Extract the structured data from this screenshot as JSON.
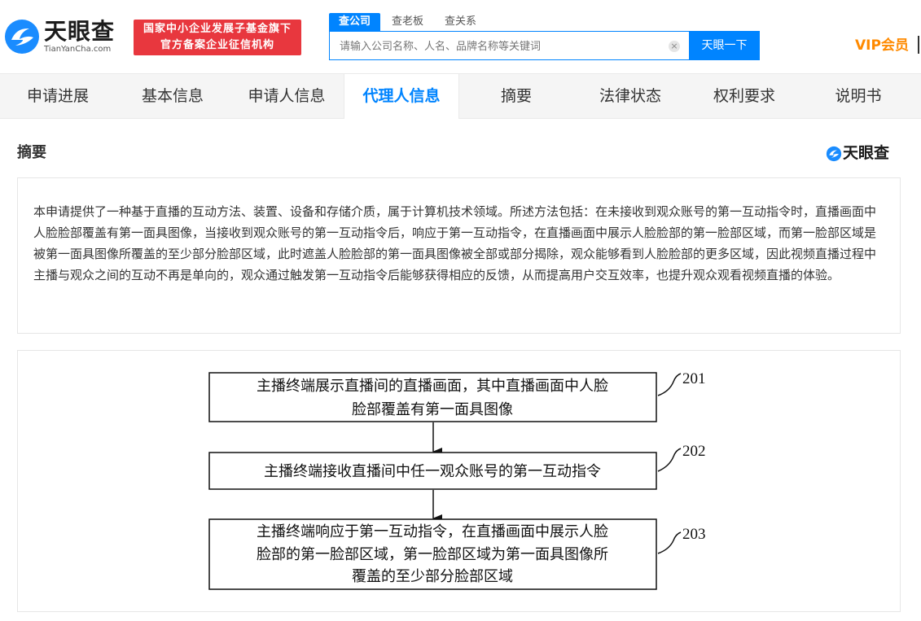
{
  "header": {
    "logo_title": "天眼查",
    "logo_domain": "TianYanCha.com",
    "badge_line1": "国家中小企业发展子基金旗下",
    "badge_line2": "官方备案企业征信机构",
    "search_tabs": [
      "查公司",
      "查老板",
      "查关系"
    ],
    "search_placeholder": "请输入公司名称、人名、品牌名称等关键词",
    "search_button": "天眼一下",
    "vip_label": "VIP会员"
  },
  "nav": {
    "tabs": [
      "申请进展",
      "基本信息",
      "申请人信息",
      "代理人信息",
      "摘要",
      "法律状态",
      "权利要求",
      "说明书"
    ],
    "active_index": 3
  },
  "abstract": {
    "title": "摘要",
    "brand": "天眼查",
    "text": "本申请提供了一种基于直播的互动方法、装置、设备和存储介质，属于计算机技术领域。所述方法包括：在未接收到观众账号的第一互动指令时，直播画面中人脸脸部覆盖有第一面具图像，当接收到观众账号的第一互动指令后，响应于第一互动指令，在直播画面中展示人脸脸部的第一脸部区域，而第一脸部区域是被第一面具图像所覆盖的至少部分脸部区域，此时遮盖人脸脸部的第一面具图像被全部或部分揭除，观众能够看到人脸脸部的更多区域，因此视频直播过程中主播与观众之间的互动不再是单向的，观众通过触发第一互动指令后能够获得相应的反馈，从而提高用户交互效率，也提升观众观看视频直播的体验。"
  },
  "figure": {
    "steps": [
      {
        "lines": [
          "主播终端展示直播间的直播画面，其中直播画面中人脸",
          "脸部覆盖有第一面具图像"
        ],
        "ref": "201"
      },
      {
        "lines": [
          "主播终端接收直播间中任一观众账号的第一互动指令"
        ],
        "ref": "202"
      },
      {
        "lines": [
          "主播终端响应于第一互动指令，在直播画面中展示人脸",
          "脸部的第一脸部区域，第一脸部区域为第一面具图像所",
          "覆盖的至少部分脸部区域"
        ],
        "ref": "203"
      }
    ]
  },
  "colors": {
    "brand_blue": "#0084ff",
    "badge_red": "#e8373e",
    "vip_orange": "#ff8a00"
  }
}
